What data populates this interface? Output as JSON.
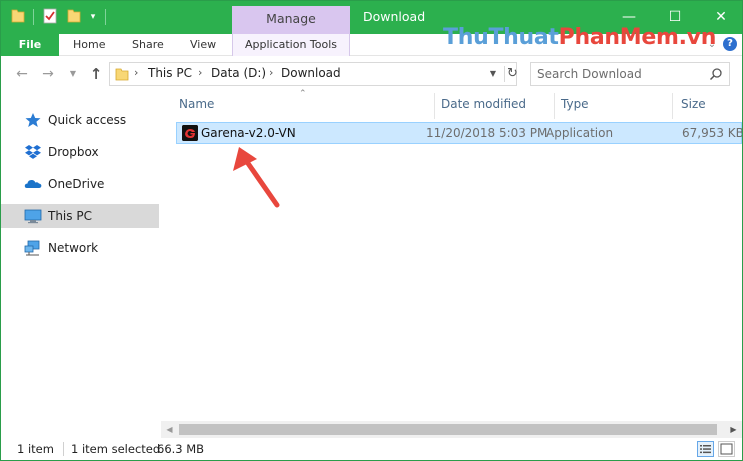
{
  "titlebar": {
    "context_tab": "Manage",
    "title": "Download",
    "minimize_glyph": "—",
    "maximize_glyph": "☐",
    "close_glyph": "✕",
    "quick_access_dropdown": "▾"
  },
  "ribbon": {
    "file_tab": "File",
    "tabs": [
      "Home",
      "Share",
      "View",
      "Application Tools"
    ],
    "expand_glyph": "⌄",
    "help_glyph": "?"
  },
  "watermark": {
    "part1": "Thu",
    "part2": "Thuat",
    "part3": "Phan",
    "part4": "Mem",
    "part5": ".vn"
  },
  "nav": {
    "back_glyph": "←",
    "forward_glyph": "→",
    "recent_glyph": "▼",
    "up_glyph": "↑",
    "breadcrumb": [
      "This PC",
      "Data (D:)",
      "Download"
    ],
    "chevron": "›",
    "dropdown_glyph": "▼",
    "refresh_glyph": "↻",
    "search_placeholder": "Search Download"
  },
  "sidebar": {
    "items": [
      {
        "label": "Quick access",
        "icon": "star-icon",
        "selected": false
      },
      {
        "label": "Dropbox",
        "icon": "dropbox-icon",
        "selected": false
      },
      {
        "label": "OneDrive",
        "icon": "cloud-icon",
        "selected": false
      },
      {
        "label": "This PC",
        "icon": "computer-icon",
        "selected": true
      },
      {
        "label": "Network",
        "icon": "network-icon",
        "selected": false
      }
    ]
  },
  "filelist": {
    "sort_glyph": "⌃",
    "columns": [
      "Name",
      "Date modified",
      "Type",
      "Size"
    ],
    "rows": [
      {
        "name": "Garena-v2.0-VN",
        "date_modified": "11/20/2018 5:03 PM",
        "type": "Application",
        "size": "67,953 KB",
        "selected": true
      }
    ]
  },
  "scrollbar": {
    "left_glyph": "◀",
    "right_glyph": "▶"
  },
  "status": {
    "item_count": "1 item",
    "selection": "1 item selected",
    "selection_size": "66.3 MB"
  },
  "colors": {
    "titlebar": "#2cb04e",
    "manage_tab": "#d9c6ef",
    "selection": "#cce8ff",
    "annotation_arrow": "#e8473d",
    "watermark_blue": "#5a9fd8",
    "watermark_red": "#e8473d"
  }
}
